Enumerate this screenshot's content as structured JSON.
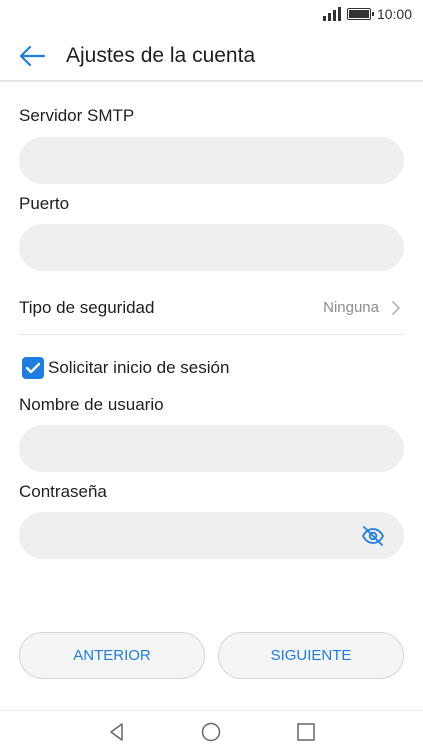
{
  "status_bar": {
    "time": "10:00"
  },
  "header": {
    "title": "Ajustes de la cuenta"
  },
  "form": {
    "smtp_server": {
      "label": "Servidor SMTP",
      "value": ""
    },
    "port": {
      "label": "Puerto",
      "value": ""
    },
    "security": {
      "label": "Tipo de seguridad",
      "value": "Ninguna"
    },
    "require_signin": {
      "label": "Solicitar inicio de sesión",
      "checked": true
    },
    "username": {
      "label": "Nombre de usuario",
      "value": ""
    },
    "password": {
      "label": "Contraseña",
      "value": ""
    }
  },
  "buttons": {
    "previous": "ANTERIOR",
    "next": "SIGUIENTE"
  },
  "colors": {
    "accent": "#1e7ee0",
    "field_bg": "#efefef",
    "secondary_text": "#8c8c8c"
  },
  "icons": [
    "signal-icon",
    "battery-icon",
    "back-arrow-icon",
    "chevron-right-icon",
    "checkmark-icon",
    "eye-off-icon",
    "nav-back-icon",
    "nav-home-icon",
    "nav-recent-icon"
  ]
}
